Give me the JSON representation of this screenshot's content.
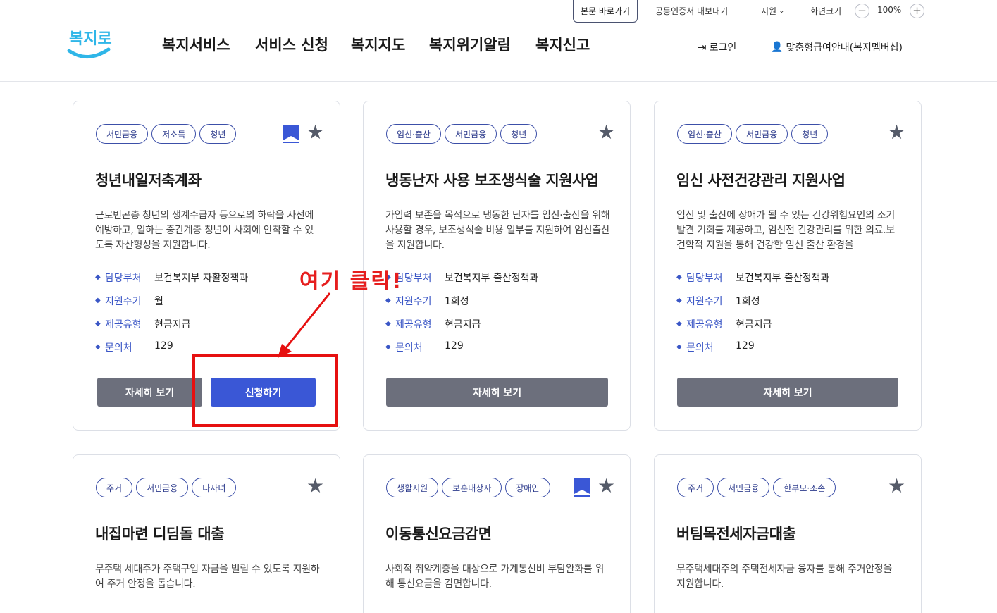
{
  "header": {
    "skip_link": "본문 바로가기",
    "cert_export": "공동인증서 내보내기",
    "language": "지원",
    "zoom_label": "화면크기",
    "zoom_value": "100%",
    "zoom_out": "−",
    "zoom_in": "+",
    "logo_text": "복지로",
    "nav": [
      "복지서비스",
      "서비스 신청",
      "복지지도",
      "복지위기알림",
      "복지신고"
    ],
    "login": "로그인",
    "membership": "맞춤형급여안내(복지멤버십)"
  },
  "cards": [
    {
      "tags": [
        "서민금융",
        "저소득",
        "청년"
      ],
      "bookmarked": true,
      "title": "청년내일저축계좌",
      "desc": "근로빈곤층 청년의 생계수급자 등으로의 하락을 사전에 예방하고, 일하는 중간계층 청년이 사회에 안착할 수 있도록 자산형성을 지원합니다.",
      "info": [
        {
          "key": "담당부처",
          "val": "보건복지부 자활정책과"
        },
        {
          "key": "지원주기",
          "val": "월"
        },
        {
          "key": "제공유형",
          "val": "현금지급"
        },
        {
          "key": "문의처",
          "val": "129"
        }
      ],
      "detail_btn": "자세히 보기",
      "apply_btn": "신청하기"
    },
    {
      "tags": [
        "임신·출산",
        "서민금융",
        "청년"
      ],
      "bookmarked": false,
      "title": "냉동난자 사용 보조생식술 지원사업",
      "desc": "가임력 보존을 목적으로 냉동한 난자를 임신·출산을 위해 사용할 경우, 보조생식술 비용 일부를 지원하여 임신출산을 지원합니다.",
      "info": [
        {
          "key": "담당부처",
          "val": "보건복지부 출산정책과"
        },
        {
          "key": "지원주기",
          "val": "1회성"
        },
        {
          "key": "제공유형",
          "val": "현금지급"
        },
        {
          "key": "문의처",
          "val": "129"
        }
      ],
      "detail_btn": "자세히 보기"
    },
    {
      "tags": [
        "임신·출산",
        "서민금융",
        "청년"
      ],
      "bookmarked": false,
      "title": "임신 사전건강관리 지원사업",
      "desc": "임신 및 출산에 장애가 될 수 있는 건강위험요인의 조기 발견 기회를 제공하고, 임신전 건강관리를 위한 의료.보건학적 지원을 통해 건강한 임신 출산 환경을",
      "info": [
        {
          "key": "담당부처",
          "val": "보건복지부 출산정책과"
        },
        {
          "key": "지원주기",
          "val": "1회성"
        },
        {
          "key": "제공유형",
          "val": "현금지급"
        },
        {
          "key": "문의처",
          "val": "129"
        }
      ],
      "detail_btn": "자세히 보기"
    },
    {
      "tags": [
        "주거",
        "서민금융",
        "다자녀"
      ],
      "bookmarked": false,
      "title": "내집마련 디딤돌 대출",
      "desc": "무주택 세대주가 주택구입 자금을 빌릴 수 있도록 지원하여 주거 안정을 돕습니다."
    },
    {
      "tags": [
        "생활지원",
        "보훈대상자",
        "장애인"
      ],
      "bookmarked": true,
      "title": "이동통신요금감면",
      "desc": "사회적 취약계층을 대상으로 가계통신비 부담완화를 위해 통신요금을 감면합니다."
    },
    {
      "tags": [
        "주거",
        "서민금융",
        "한부모·조손"
      ],
      "bookmarked": false,
      "title": "버팀목전세자금대출",
      "desc": "무주택세대주의 주택전세자금 융자를 통해 주거안정을 지원합니다."
    }
  ],
  "annotation": {
    "text": "여기 클릭!",
    "color": "#e61e1e"
  },
  "colors": {
    "accent_blue": "#3a57d6",
    "tag_border": "#3c4fa8",
    "button_gray": "#6c6f7c",
    "logo_cyan": "#2fb6e8"
  }
}
